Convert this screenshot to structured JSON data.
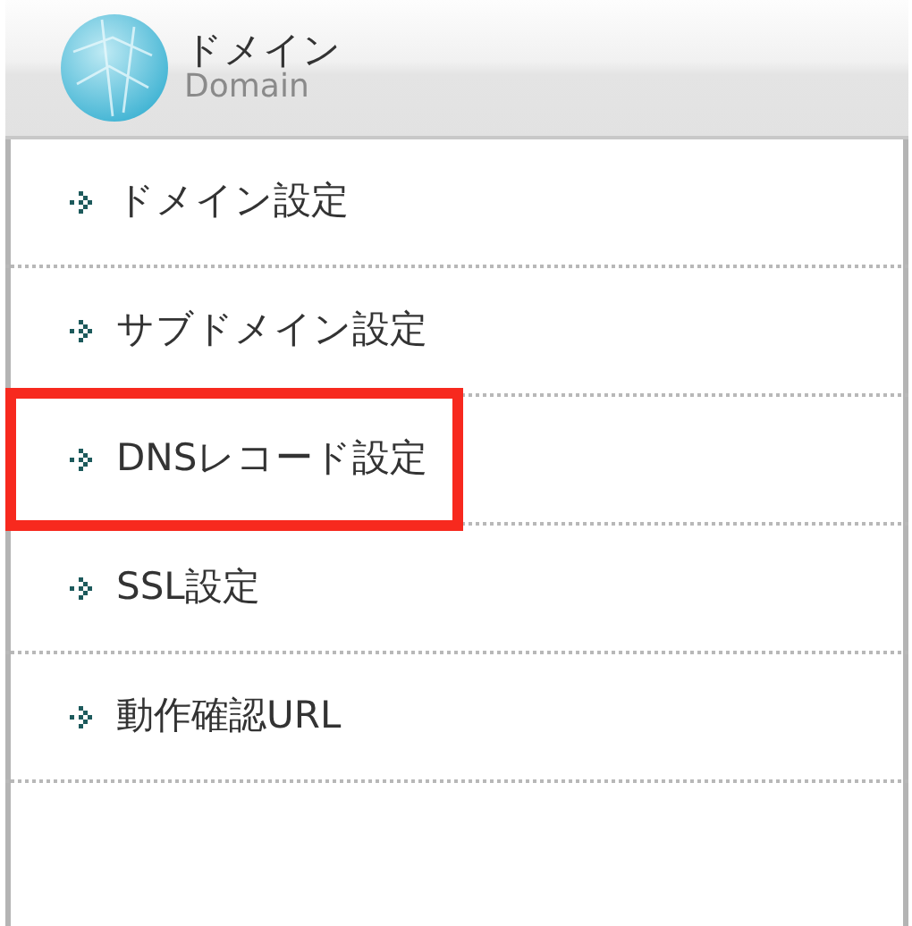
{
  "header": {
    "title": "ドメイン",
    "subtitle": "Domain"
  },
  "menu": [
    {
      "label": "ドメイン設定",
      "highlighted": false
    },
    {
      "label": "サブドメイン設定",
      "highlighted": false
    },
    {
      "label": "DNSレコード設定",
      "highlighted": true
    },
    {
      "label": "SSL設定",
      "highlighted": false
    },
    {
      "label": "動作確認URL",
      "highlighted": false
    }
  ]
}
